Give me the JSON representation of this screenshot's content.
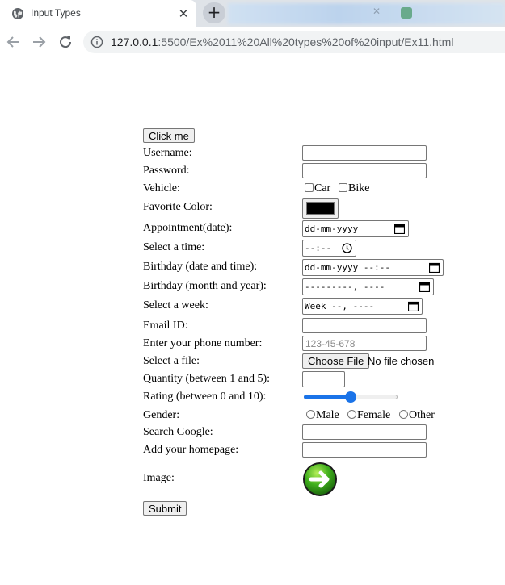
{
  "browser": {
    "tab_title": "Input Types",
    "new_tab_icon": "plus-icon",
    "url_host": "127.0.0.1",
    "url_path": ":5500/Ex%2011%20All%20types%20of%20input/Ex11.html"
  },
  "form": {
    "click_me_label": "Click me",
    "username_label": "Username:",
    "password_label": "Password:",
    "vehicle_label": "Vehicle:",
    "vehicle_options": [
      "Car",
      "Bike"
    ],
    "favorite_color_label": "Favorite Color:",
    "favorite_color_value": "#000000",
    "appointment_label": "Appointment(date):",
    "appointment_placeholder": "dd-mm-yyyy",
    "time_label": "Select a time:",
    "time_placeholder": "--:--",
    "birthday_datetime_label": "Birthday (date and time):",
    "birthday_datetime_placeholder": "dd-mm-yyyy --:--",
    "birthday_month_label": "Birthday (month and year):",
    "birthday_month_placeholder": "---------, ----",
    "week_label": "Select a week:",
    "week_placeholder": "Week --, ----",
    "email_label": "Email ID:",
    "phone_label": "Enter your phone number:",
    "phone_placeholder": "123-45-678",
    "file_label": "Select a file:",
    "file_button_label": "Choose File",
    "file_status": "No file chosen",
    "quantity_label": "Quantity (between 1 and 5):",
    "rating_label": "Rating (between 0 and 10):",
    "rating_value": 5,
    "rating_min": 0,
    "rating_max": 10,
    "gender_label": "Gender:",
    "gender_options": [
      "Male",
      "Female",
      "Other"
    ],
    "search_label": "Search Google:",
    "homepage_label": "Add your homepage:",
    "image_label": "Image:",
    "image_icon": "green-arrow-right-icon",
    "submit_label": "Submit"
  },
  "colors": {
    "slider_accent": "#1a73e8",
    "image_button_green": "#3fae1c"
  }
}
